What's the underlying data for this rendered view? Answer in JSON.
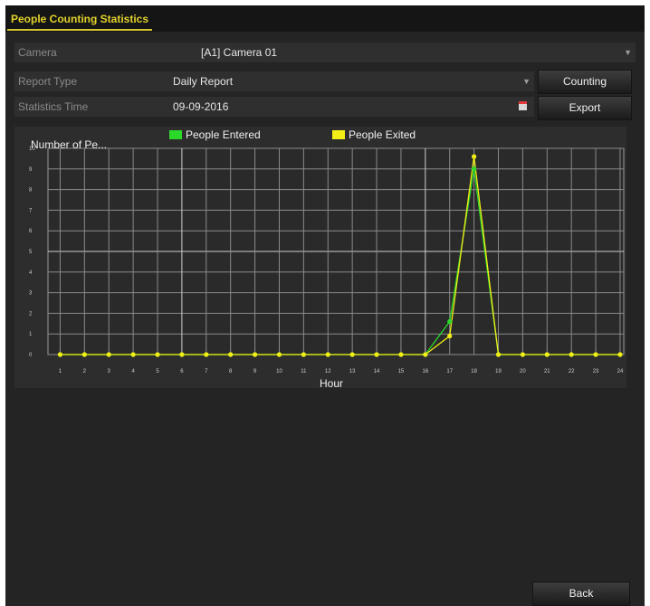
{
  "window": {
    "tab_title": "People Counting Statistics"
  },
  "form": {
    "camera_label": "Camera",
    "camera_value": "[A1] Camera 01",
    "report_type_label": "Report Type",
    "report_type_value": "Daily Report",
    "statistics_time_label": "Statistics Time",
    "statistics_time_value": "09-09-2016"
  },
  "buttons": {
    "counting": "Counting",
    "export": "Export",
    "back": "Back"
  },
  "icons": {
    "dropdown": "chevron-down-icon",
    "calendar": "calendar-icon"
  },
  "colors": {
    "accent": "#e3d22b",
    "entered": "#2bd92b",
    "exited": "#f2ee16"
  },
  "chart_data": {
    "type": "line",
    "ylabel": "Number of Pe...",
    "xlabel": "Hour",
    "x": [
      "1",
      "2",
      "3",
      "4",
      "5",
      "6",
      "7",
      "8",
      "9",
      "10",
      "11",
      "12",
      "13",
      "14",
      "15",
      "16",
      "17",
      "18",
      "19",
      "20",
      "21",
      "22",
      "23",
      "24"
    ],
    "ylim": [
      0,
      10
    ],
    "yticks": [
      "0",
      "1",
      "2",
      "3",
      "4",
      "5",
      "6",
      "7",
      "8",
      "9",
      "10"
    ],
    "grid": true,
    "legend_position": "top",
    "series": [
      {
        "name": "People Entered",
        "color": "#2bd92b",
        "values": [
          0,
          0,
          0,
          0,
          0,
          0,
          0,
          0,
          0,
          0,
          0,
          0,
          0,
          0,
          0,
          0,
          1.6,
          9,
          0,
          0,
          0,
          0,
          0,
          0
        ]
      },
      {
        "name": "People Exited",
        "color": "#f2ee16",
        "values": [
          0,
          0,
          0,
          0,
          0,
          0,
          0,
          0,
          0,
          0,
          0,
          0,
          0,
          0,
          0,
          0,
          0.9,
          9.6,
          0,
          0,
          0,
          0,
          0,
          0
        ]
      }
    ]
  }
}
